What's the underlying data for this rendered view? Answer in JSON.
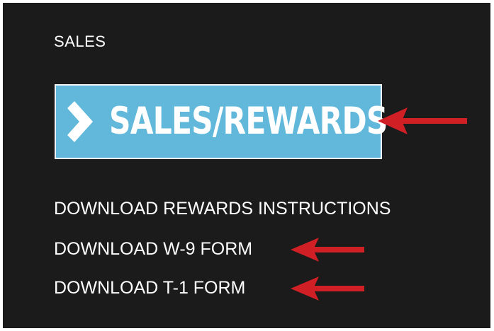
{
  "section": {
    "title": "SALES"
  },
  "cta": {
    "label": "SALES/REWARDS",
    "icon": "chevron-right-icon"
  },
  "links": [
    {
      "label": "DOWNLOAD REWARDS INSTRUCTIONS"
    },
    {
      "label": "DOWNLOAD W-9 FORM"
    },
    {
      "label": "DOWNLOAD T-1 FORM"
    }
  ],
  "annotations": {
    "arrow_color": "#d11f26",
    "arrow_icon": "arrow-left-icon"
  },
  "colors": {
    "background": "#1b1b1b",
    "button": "#62b8da",
    "text": "#ffffff"
  }
}
